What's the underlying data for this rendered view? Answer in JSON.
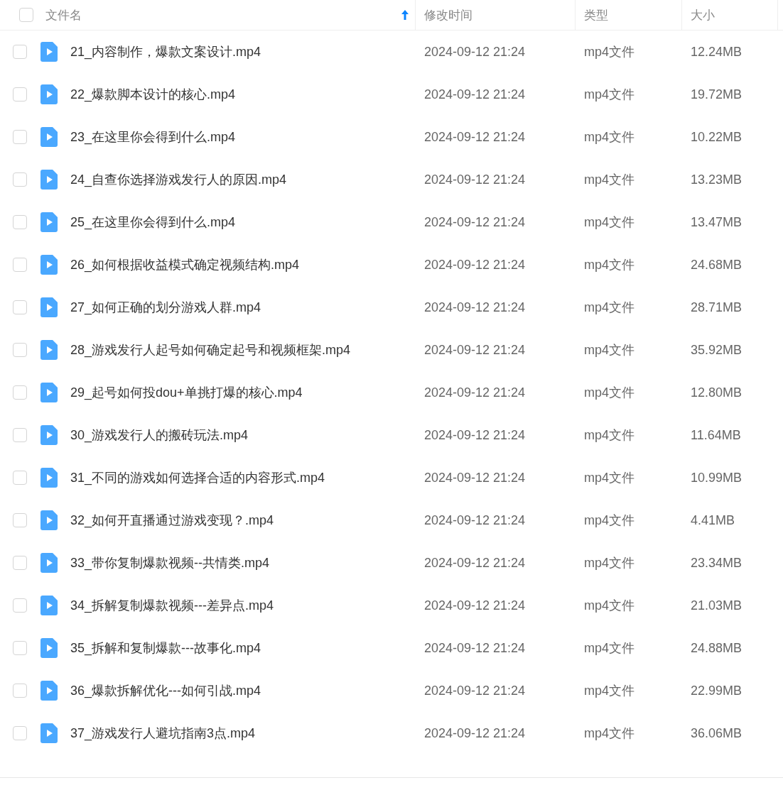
{
  "header": {
    "checked": false,
    "columns": [
      {
        "label": "文件名",
        "sorted": true
      },
      {
        "label": "修改时间",
        "sorted": false
      },
      {
        "label": "类型",
        "sorted": false
      },
      {
        "label": "大小",
        "sorted": false
      }
    ]
  },
  "rows": [
    {
      "name": "21_内容制作，爆款文案设计.mp4",
      "modified": "2024-09-12 21:24",
      "type": "mp4文件",
      "size": "12.24MB",
      "checked": false
    },
    {
      "name": "22_爆款脚本设计的核心.mp4",
      "modified": "2024-09-12 21:24",
      "type": "mp4文件",
      "size": "19.72MB",
      "checked": false
    },
    {
      "name": "23_在这里你会得到什么.mp4",
      "modified": "2024-09-12 21:24",
      "type": "mp4文件",
      "size": "10.22MB",
      "checked": false
    },
    {
      "name": "24_自查你选择游戏发行人的原因.mp4",
      "modified": "2024-09-12 21:24",
      "type": "mp4文件",
      "size": "13.23MB",
      "checked": false
    },
    {
      "name": "25_在这里你会得到什么.mp4",
      "modified": "2024-09-12 21:24",
      "type": "mp4文件",
      "size": "13.47MB",
      "checked": false
    },
    {
      "name": "26_如何根据收益模式确定视频结构.mp4",
      "modified": "2024-09-12 21:24",
      "type": "mp4文件",
      "size": "24.68MB",
      "checked": false
    },
    {
      "name": "27_如何正确的划分游戏人群.mp4",
      "modified": "2024-09-12 21:24",
      "type": "mp4文件",
      "size": "28.71MB",
      "checked": false
    },
    {
      "name": "28_游戏发行人起号如何确定起号和视频框架.mp4",
      "modified": "2024-09-12 21:24",
      "type": "mp4文件",
      "size": "35.92MB",
      "checked": false
    },
    {
      "name": "29_起号如何投dou+单挑打爆的核心.mp4",
      "modified": "2024-09-12 21:24",
      "type": "mp4文件",
      "size": "12.80MB",
      "checked": false
    },
    {
      "name": "30_游戏发行人的搬砖玩法.mp4",
      "modified": "2024-09-12 21:24",
      "type": "mp4文件",
      "size": "11.64MB",
      "checked": false
    },
    {
      "name": "31_不同的游戏如何选择合适的内容形式.mp4",
      "modified": "2024-09-12 21:24",
      "type": "mp4文件",
      "size": "10.99MB",
      "checked": false
    },
    {
      "name": "32_如何开直播通过游戏变现？.mp4",
      "modified": "2024-09-12 21:24",
      "type": "mp4文件",
      "size": "4.41MB",
      "checked": false
    },
    {
      "name": "33_带你复制爆款视频--共情类.mp4",
      "modified": "2024-09-12 21:24",
      "type": "mp4文件",
      "size": "23.34MB",
      "checked": false
    },
    {
      "name": "34_拆解复制爆款视频---差异点.mp4",
      "modified": "2024-09-12 21:24",
      "type": "mp4文件",
      "size": "21.03MB",
      "checked": false
    },
    {
      "name": "35_拆解和复制爆款---故事化.mp4",
      "modified": "2024-09-12 21:24",
      "type": "mp4文件",
      "size": "24.88MB",
      "checked": false
    },
    {
      "name": "36_爆款拆解优化---如何引战.mp4",
      "modified": "2024-09-12 21:24",
      "type": "mp4文件",
      "size": "22.99MB",
      "checked": false
    },
    {
      "name": "37_游戏发行人避坑指南3点.mp4",
      "modified": "2024-09-12 21:24",
      "type": "mp4文件",
      "size": "36.06MB",
      "checked": false
    }
  ]
}
